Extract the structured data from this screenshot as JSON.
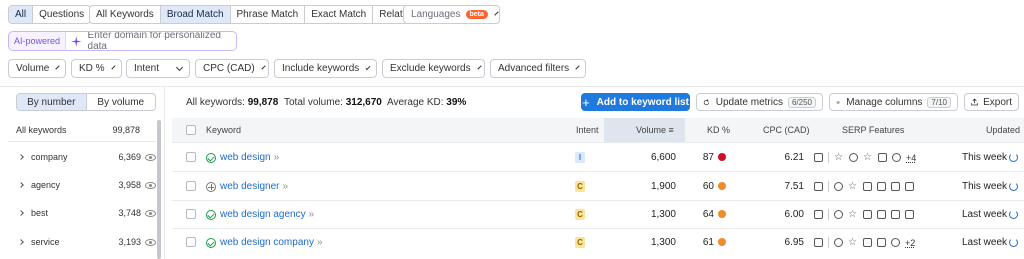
{
  "match_tabs": {
    "all": "All",
    "questions": "Questions"
  },
  "keyword_tabs": [
    {
      "label": "All Keywords",
      "active": false
    },
    {
      "label": "Broad Match",
      "active": true
    },
    {
      "label": "Phrase Match",
      "active": false
    },
    {
      "label": "Exact Match",
      "active": false
    },
    {
      "label": "Related",
      "active": false
    }
  ],
  "languages": {
    "label": "Languages",
    "badge": "beta"
  },
  "ai": {
    "label": "AI-powered",
    "placeholder": "Enter domain for personalized data"
  },
  "filters": [
    "Volume",
    "KD %",
    "Intent",
    "CPC (CAD)",
    "Include keywords",
    "Exclude keywords",
    "Advanced filters"
  ],
  "sidebar": {
    "by_number": "By number",
    "by_volume": "By volume",
    "header_label": "All keywords",
    "header_count": "99,878",
    "groups": [
      {
        "label": "company",
        "count": "6,369"
      },
      {
        "label": "agency",
        "count": "3,958"
      },
      {
        "label": "best",
        "count": "3,748"
      },
      {
        "label": "service",
        "count": "3,193"
      }
    ]
  },
  "summary": {
    "all_keywords_label": "All keywords:",
    "all_keywords_value": "99,878",
    "total_volume_label": "Total volume:",
    "total_volume_value": "312,670",
    "avg_kd_label": "Average KD:",
    "avg_kd_value": "39%"
  },
  "actions": {
    "add_to_list": "Add to keyword list",
    "update_metrics": "Update metrics",
    "update_count": "6/250",
    "manage_columns": "Manage columns",
    "columns_count": "7/10",
    "export": "Export"
  },
  "table": {
    "headers": {
      "keyword": "Keyword",
      "intent": "Intent",
      "volume": "Volume",
      "kd": "KD %",
      "cpc": "CPC (CAD)",
      "serp": "SERP Features",
      "updated": "Updated"
    },
    "rows": [
      {
        "keyword": "web design",
        "status": "ok",
        "intent": "I",
        "intent_color": "#dbe9fb",
        "intent_text": "#3b7bd8",
        "volume": "6,600",
        "kd": "87",
        "kd_color": "#d40d2a",
        "cpc": "6.21",
        "more": "+4",
        "updated": "This week"
      },
      {
        "keyword": "web designer",
        "status": "add",
        "intent": "C",
        "intent_color": "#fbe39a",
        "intent_text": "#8a6a00",
        "volume": "1,900",
        "kd": "60",
        "kd_color": "#f08a2c",
        "cpc": "7.51",
        "more": "",
        "updated": "This week"
      },
      {
        "keyword": "web design agency",
        "status": "ok",
        "intent": "C",
        "intent_color": "#fbe39a",
        "intent_text": "#8a6a00",
        "volume": "1,300",
        "kd": "64",
        "kd_color": "#f08a2c",
        "cpc": "6.00",
        "more": "",
        "updated": "Last week"
      },
      {
        "keyword": "web design company",
        "status": "ok",
        "intent": "C",
        "intent_color": "#fbe39a",
        "intent_text": "#8a6a00",
        "volume": "1,300",
        "kd": "61",
        "kd_color": "#f08a2c",
        "cpc": "6.95",
        "more": "+2",
        "updated": "Last week"
      }
    ]
  }
}
